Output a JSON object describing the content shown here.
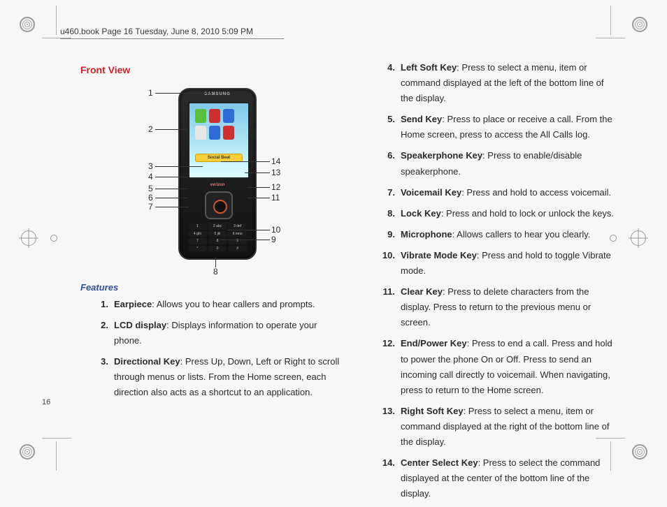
{
  "header_text": "u460.book  Page 16  Tuesday, June 8, 2010  5:09 PM",
  "page_number": "16",
  "front_view_heading": "Front View",
  "features_heading": "Features",
  "phone_brand": "SAMSUNG",
  "phone_carrier": "verizon",
  "social_beat_label": "Social Beat",
  "diagram_labels": {
    "n1": "1",
    "n2": "2",
    "n3": "3",
    "n4": "4",
    "n5": "5",
    "n6": "6",
    "n7": "7",
    "n8": "8",
    "n9": "9",
    "n10": "10",
    "n11": "11",
    "n12": "12",
    "n13": "13",
    "n14": "14"
  },
  "features": {
    "f1": {
      "num": "1.",
      "term": "Earpiece",
      "desc": ": Allows you to hear callers and prompts."
    },
    "f2": {
      "num": "2.",
      "term": "LCD display",
      "desc": ": Displays information to operate your phone."
    },
    "f3": {
      "num": "3.",
      "term": "Directional Key",
      "desc": ": Press Up, Down, Left or Right to scroll through menus or lists. From the Home screen, each direction also acts as a shortcut to an application."
    },
    "f4": {
      "num": "4.",
      "term": "Left Soft Key",
      "desc": ": Press to select a menu, item or command displayed at the left of the bottom line of the display."
    },
    "f5": {
      "num": "5.",
      "term": "Send Key",
      "desc": ": Press to place or receive a call. From the Home screen, press to access the All Calls log."
    },
    "f6": {
      "num": "6.",
      "term": "Speakerphone Key",
      "desc": ": Press to enable/disable speakerphone."
    },
    "f7": {
      "num": "7.",
      "term": "Voicemail Key",
      "desc": ": Press and hold to access voicemail."
    },
    "f8": {
      "num": "8.",
      "term": "Lock Key",
      "desc": ": Press and hold to lock or unlock the keys."
    },
    "f9": {
      "num": "9.",
      "term": "Microphone",
      "desc": ": Allows callers to hear you clearly."
    },
    "f10": {
      "num": "10.",
      "term": "Vibrate Mode Key",
      "desc": ": Press and hold to toggle Vibrate mode."
    },
    "f11": {
      "num": "11.",
      "term": "Clear Key",
      "desc": ": Press to delete characters from the display. Press to return to the previous menu or screen."
    },
    "f12": {
      "num": "12.",
      "term": "End/Power Key",
      "desc": ": Press to end a call. Press and hold to power the phone On or Off. Press to send an incoming call directly to voicemail. When navigating, press to return to the Home screen."
    },
    "f13": {
      "num": "13.",
      "term": "Right Soft Key",
      "desc": ": Press to select a menu, item or command displayed at the right of the bottom line of the display."
    },
    "f14": {
      "num": "14.",
      "term": "Center Select Key",
      "desc": ": Press to select the command displayed at the center of the bottom line of the display."
    }
  }
}
